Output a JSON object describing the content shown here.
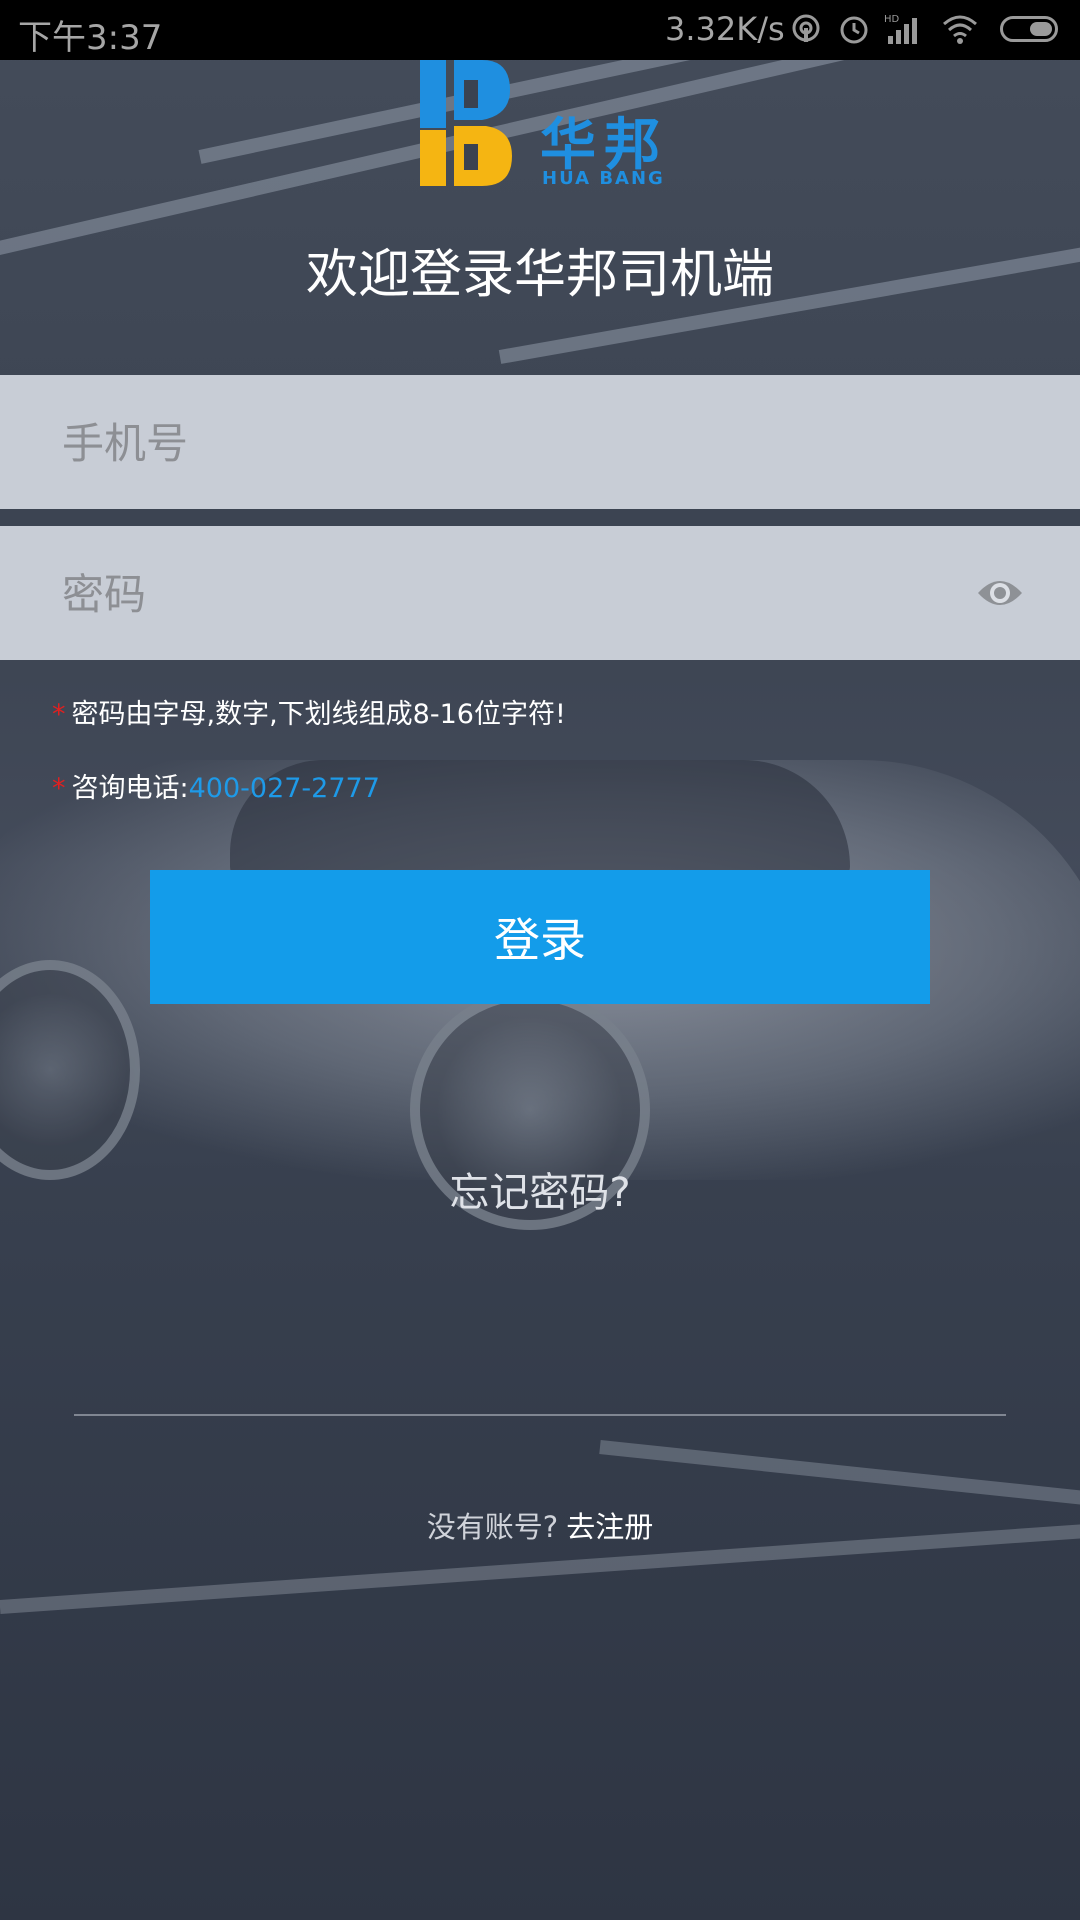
{
  "status_bar": {
    "time": "下午3:37",
    "network_speed": "3.32K/s",
    "icons": [
      "hotspot-icon",
      "alarm-icon",
      "signal-hd-icon",
      "wifi-icon",
      "battery-icon"
    ]
  },
  "logo": {
    "brand_cn": "华邦",
    "brand_en": "HUA BANG"
  },
  "welcome_title": "欢迎登录华邦司机端",
  "form": {
    "phone_placeholder": "手机号",
    "password_placeholder": "密码",
    "password_visibility_icon": "eye-icon"
  },
  "hints": {
    "password_rule": "密码由字母,数字,下划线组成8-16位字符!",
    "hotline_label": "咨询电话:",
    "hotline_number": "400-027-2777",
    "required_mark": "*"
  },
  "login_button": "登录",
  "forgot_password": "忘记密码?",
  "register": {
    "prompt": "没有账号?",
    "link": "去注册"
  },
  "colors": {
    "accent": "#139cea",
    "logo_blue": "#1f8fe0",
    "logo_yellow": "#f5b512",
    "required_red": "#e02020"
  }
}
